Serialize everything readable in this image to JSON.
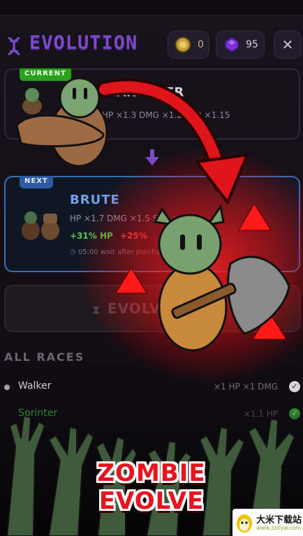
{
  "header": {
    "title": "EVOLUTION",
    "coins": "0",
    "gems": "95",
    "close_label": "✕"
  },
  "current": {
    "tag": "CURRENT",
    "name": "WANDERER",
    "stats": "HP ×1.3  DMG ×1.2  SPD ×1.15"
  },
  "next": {
    "tag": "NEXT",
    "name": "BRUTE",
    "stats": "HP ×1.7  DMG ×1.5  SPD ×1.10",
    "bonus_hp": "+31% HP",
    "bonus_dmg": "+25%",
    "wait": "◷ 05:00 wait after purchase"
  },
  "evolve_button": {
    "label": "EVOLVE",
    "icon": "hourglass-icon"
  },
  "races": {
    "heading": "ALL RACES",
    "items": [
      {
        "name": "Walker",
        "stats": "×1 HP  ×1 DMG",
        "status": "unlocked"
      },
      {
        "name": "Sprinter",
        "stats": "×1.1 HP",
        "status": "current"
      }
    ]
  },
  "promo": {
    "line1": "ZOMBIE",
    "line2": "EVOLVE"
  },
  "watermark": {
    "name": "大米下载站",
    "url": "www.zzllyw.com"
  },
  "colors": {
    "accent": "#7b49c9",
    "next_border": "#3a6db5",
    "glow_red": "#ff1a1a",
    "promo_red": "#e8131e"
  }
}
